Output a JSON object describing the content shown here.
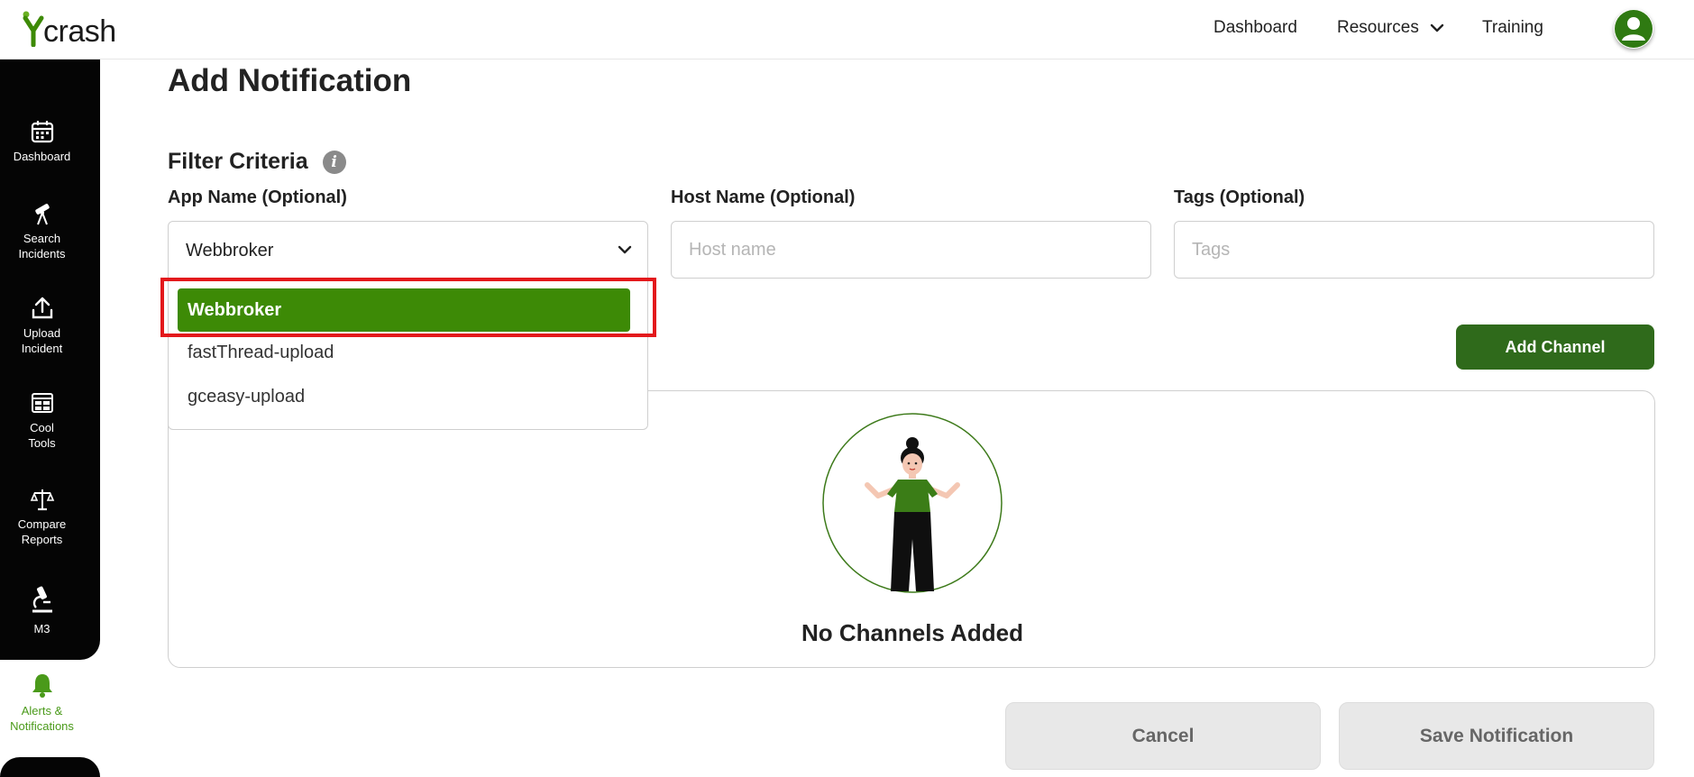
{
  "header": {
    "logo_text": "crash",
    "nav": {
      "dashboard": "Dashboard",
      "resources": "Resources",
      "training": "Training"
    }
  },
  "sidebar": {
    "items": [
      {
        "label_line1": "Dashboard",
        "label_line2": "",
        "icon": "calendar-icon"
      },
      {
        "label_line1": "Search",
        "label_line2": "Incidents",
        "icon": "telescope-icon"
      },
      {
        "label_line1": "Upload",
        "label_line2": "Incident",
        "icon": "upload-icon"
      },
      {
        "label_line1": "Cool",
        "label_line2": "Tools",
        "icon": "tools-grid-icon"
      },
      {
        "label_line1": "Compare",
        "label_line2": "Reports",
        "icon": "scale-icon"
      },
      {
        "label_line1": "M3",
        "label_line2": "",
        "icon": "microscope-icon"
      }
    ],
    "active": {
      "label_line1": "Alerts &",
      "label_line2": "Notifications",
      "icon": "bell-icon"
    }
  },
  "main": {
    "page_title": "Add Notification",
    "filter_title": "Filter Criteria",
    "app_name": {
      "label": "App Name (Optional)",
      "selected": "Webbroker",
      "options": [
        "Webbroker",
        "fastThread-upload",
        "gceasy-upload"
      ]
    },
    "host_name": {
      "label": "Host Name (Optional)",
      "value": "",
      "placeholder": "Host name"
    },
    "tags": {
      "label": "Tags (Optional)",
      "value": "",
      "placeholder": "Tags"
    },
    "add_channel_label": "Add Channel",
    "empty_state_text": "No Channels Added",
    "cancel_label": "Cancel",
    "save_label": "Save Notification"
  },
  "colors": {
    "brand_green": "#3d8a06",
    "dark_green": "#2f6a1b",
    "highlight_red": "#e3191c",
    "sidebar_bg": "#050505"
  }
}
